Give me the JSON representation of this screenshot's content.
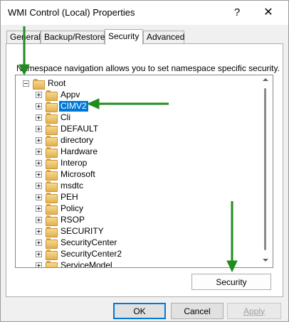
{
  "window": {
    "title": "WMI Control (Local) Properties",
    "help_glyph": "?",
    "close_glyph": "✕"
  },
  "tabs": [
    {
      "label": "General",
      "active": false
    },
    {
      "label": "Backup/Restore",
      "active": false
    },
    {
      "label": "Security",
      "active": true
    },
    {
      "label": "Advanced",
      "active": false
    }
  ],
  "security_tab": {
    "description": "Namespace navigation allows you to set namespace specific security.",
    "tree": {
      "root": {
        "label": "Root",
        "expanded": true
      },
      "children": [
        {
          "label": "Appv",
          "selected": false
        },
        {
          "label": "CIMV2",
          "selected": true
        },
        {
          "label": "Cli",
          "selected": false
        },
        {
          "label": "DEFAULT",
          "selected": false
        },
        {
          "label": "directory",
          "selected": false
        },
        {
          "label": "Hardware",
          "selected": false
        },
        {
          "label": "Interop",
          "selected": false
        },
        {
          "label": "Microsoft",
          "selected": false
        },
        {
          "label": "msdtc",
          "selected": false
        },
        {
          "label": "PEH",
          "selected": false
        },
        {
          "label": "Policy",
          "selected": false
        },
        {
          "label": "RSOP",
          "selected": false
        },
        {
          "label": "SECURITY",
          "selected": false
        },
        {
          "label": "SecurityCenter",
          "selected": false
        },
        {
          "label": "SecurityCenter2",
          "selected": false
        },
        {
          "label": "ServiceModel",
          "selected": false
        }
      ]
    },
    "security_button": "Security"
  },
  "footer": {
    "ok_label": "OK",
    "cancel_label": "Cancel",
    "apply_label": "Apply"
  },
  "colors": {
    "annotation_arrow": "#1e8c1e",
    "selection": "#0078d7"
  }
}
